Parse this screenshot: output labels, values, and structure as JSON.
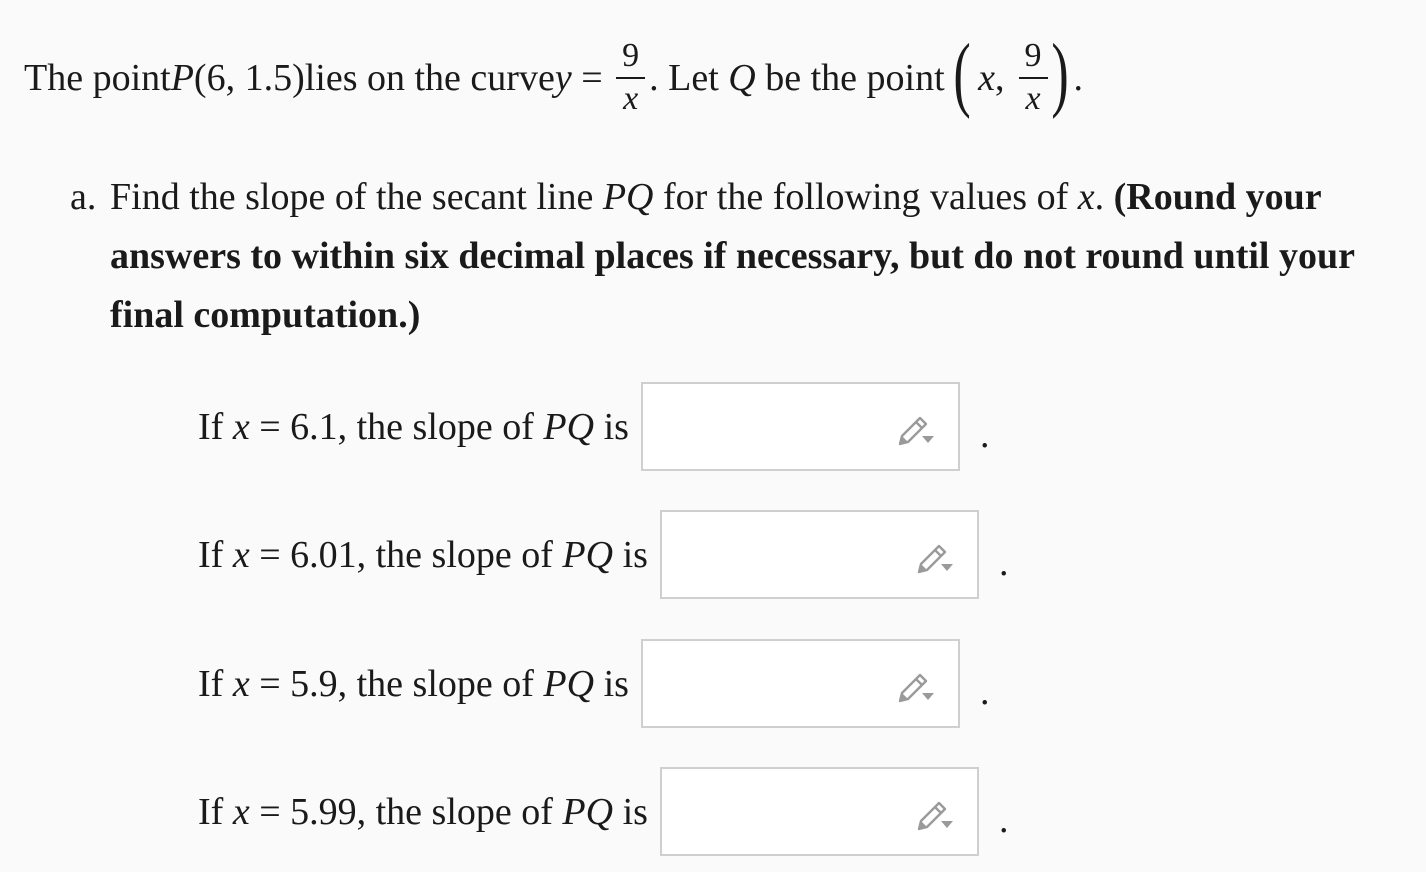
{
  "intro": {
    "t1": "The point ",
    "p": "P",
    "coords": "(6, 1.5)",
    "t2": " lies on the curve ",
    "y": "y",
    "eq": " = ",
    "num": "9",
    "den": "x",
    "t3": ". Let ",
    "q": "Q",
    "t4": " be the point ",
    "lp": "(",
    "x": "x",
    "comma": ",",
    "num2": "9",
    "den2": "x",
    "rp": ")",
    "end": "."
  },
  "part_a": {
    "marker": "a.",
    "t1": "Find the slope of the secant line ",
    "pq": "PQ",
    "t2": " for the following values of ",
    "x": "x",
    "t3": ". ",
    "bold": "(Round your answers to within six decimal places if necessary, but do not round until your final computation.)"
  },
  "questions": [
    {
      "prefix": "If ",
      "var": "x",
      "eq": " = ",
      "value": "6.1",
      "mid": ", the slope of ",
      "pq": "PQ",
      "suffix": " is",
      "answer": "",
      "period": "."
    },
    {
      "prefix": "If ",
      "var": "x",
      "eq": " = ",
      "value": "6.01",
      "mid": ", the slope of ",
      "pq": "PQ",
      "suffix": " is",
      "answer": "",
      "period": "."
    },
    {
      "prefix": "If ",
      "var": "x",
      "eq": " = ",
      "value": "5.9",
      "mid": ", the slope of ",
      "pq": "PQ",
      "suffix": " is",
      "answer": "",
      "period": "."
    },
    {
      "prefix": "If ",
      "var": "x",
      "eq": " = ",
      "value": "5.99",
      "mid": ", the slope of ",
      "pq": "PQ",
      "suffix": " is",
      "answer": "",
      "period": "."
    }
  ],
  "icons": {
    "answer_tool": "pencil-dropdown-icon"
  },
  "colors": {
    "background": "#fafafa",
    "text": "#1a1a1a",
    "box_border": "#cfcfcf",
    "icon": "#9a9a9a"
  }
}
